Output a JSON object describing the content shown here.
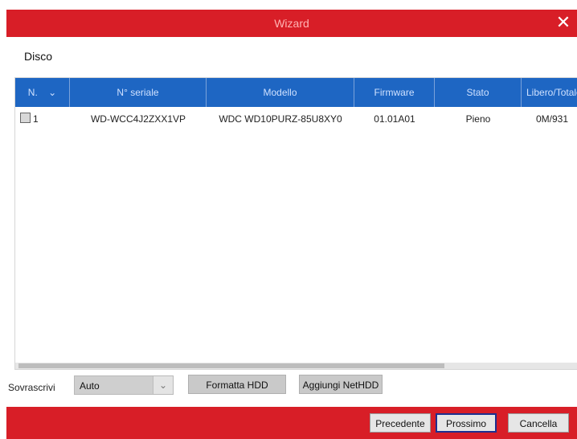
{
  "window": {
    "title": "Wizard"
  },
  "section": {
    "title": "Disco"
  },
  "table": {
    "headers": [
      "N.",
      "N° seriale",
      "Modello",
      "Firmware",
      "Stato",
      "Libero/Totale"
    ],
    "rows": [
      {
        "n": "1",
        "serial": "WD-WCC4J2ZXX1VP",
        "model": "WDC WD10PURZ-85U8XY0",
        "firmware": "01.01A01",
        "status": "Pieno",
        "free_total": "0M/931"
      }
    ]
  },
  "controls": {
    "overwrite_label": "Sovrascrivi",
    "overwrite_value": "Auto",
    "format_button": "Formatta HDD",
    "add_nethdd_button": "Aggiungi NetHDD"
  },
  "footer": {
    "prev_button": "Precedente",
    "next_button": "Prossimo",
    "cancel_button": "Cancella"
  },
  "colors": {
    "accent_red": "#d81e27",
    "header_blue": "#1e66c3"
  }
}
